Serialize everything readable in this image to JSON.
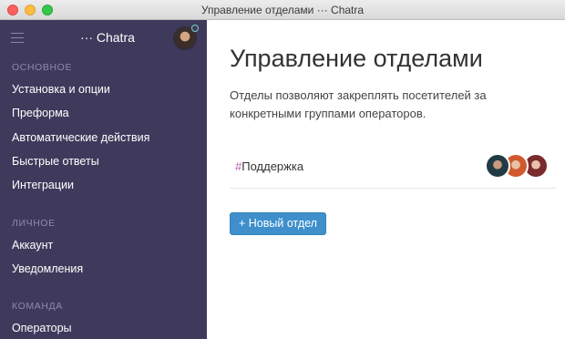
{
  "window": {
    "title": "Управление отделами ··· Chatra"
  },
  "sidebar": {
    "brand": "··· Chatra",
    "sections": [
      {
        "title": "ОСНОВНОЕ",
        "items": [
          "Установка и опции",
          "Преформа",
          "Автоматические действия",
          "Быстрые ответы",
          "Интеграции"
        ]
      },
      {
        "title": "ЛИЧНОЕ",
        "items": [
          "Аккаунт",
          "Уведомления"
        ]
      },
      {
        "title": "КОМАНДА",
        "items": [
          "Операторы"
        ]
      }
    ]
  },
  "main": {
    "title": "Управление отделами",
    "description": "Отделы позволяют закреплять посетителей за конкретными группами операторов.",
    "departments": [
      {
        "hash": "#",
        "name": "Поддержка"
      }
    ],
    "new_department_button": "+ Новый отдел"
  },
  "colors": {
    "sidebar_bg": "#3f3a5c",
    "section_title": "#8f89ad",
    "accent_button": "#3e8fcb",
    "hash": "#b05fb0"
  }
}
